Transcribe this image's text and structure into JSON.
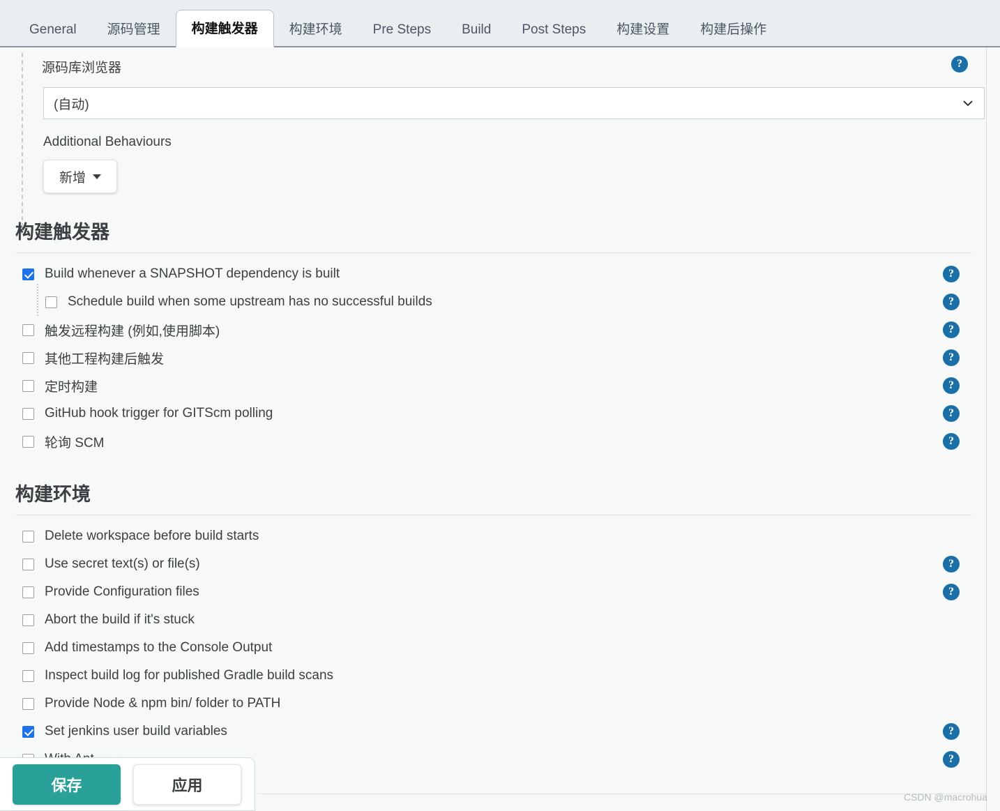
{
  "tabs": [
    {
      "label": "General",
      "active": false
    },
    {
      "label": "源码管理",
      "active": false
    },
    {
      "label": "构建触发器",
      "active": true
    },
    {
      "label": "构建环境",
      "active": false
    },
    {
      "label": "Pre Steps",
      "active": false
    },
    {
      "label": "Build",
      "active": false
    },
    {
      "label": "Post Steps",
      "active": false
    },
    {
      "label": "构建设置",
      "active": false
    },
    {
      "label": "构建后操作",
      "active": false
    }
  ],
  "scm_block": {
    "label": "源码库浏览器",
    "select_value": "(自动)",
    "select_options": [
      "(自动)"
    ],
    "additional_behaviours_label": "Additional Behaviours",
    "add_button_label": "新增",
    "help_glyph": "?",
    "chevron_icon": "chevron-down-icon"
  },
  "triggers_section": {
    "title": "构建触发器",
    "rows": [
      {
        "label": "Build whenever a SNAPSHOT dependency is built",
        "checked": true,
        "indent": false,
        "help": true
      },
      {
        "label": "Schedule build when some upstream has no successful builds",
        "checked": false,
        "indent": true,
        "help": true
      },
      {
        "label": "触发远程构建 (例如,使用脚本)",
        "checked": false,
        "indent": false,
        "help": true
      },
      {
        "label": "其他工程构建后触发",
        "checked": false,
        "indent": false,
        "help": true
      },
      {
        "label": "定时构建",
        "checked": false,
        "indent": false,
        "help": true
      },
      {
        "label": "GitHub hook trigger for GITScm polling",
        "checked": false,
        "indent": false,
        "help": true
      },
      {
        "label": "轮询 SCM",
        "checked": false,
        "indent": false,
        "help": true
      }
    ]
  },
  "environment_section": {
    "title": "构建环境",
    "rows": [
      {
        "label": "Delete workspace before build starts",
        "checked": false,
        "indent": false,
        "help": false
      },
      {
        "label": "Use secret text(s) or file(s)",
        "checked": false,
        "indent": false,
        "help": true
      },
      {
        "label": "Provide Configuration files",
        "checked": false,
        "indent": false,
        "help": true
      },
      {
        "label": "Abort the build if it's stuck",
        "checked": false,
        "indent": false,
        "help": false
      },
      {
        "label": "Add timestamps to the Console Output",
        "checked": false,
        "indent": false,
        "help": false
      },
      {
        "label": "Inspect build log for published Gradle build scans",
        "checked": false,
        "indent": false,
        "help": false
      },
      {
        "label": "Provide Node & npm bin/ folder to PATH",
        "checked": false,
        "indent": false,
        "help": false
      },
      {
        "label": "Set jenkins user build variables",
        "checked": true,
        "indent": false,
        "help": true
      },
      {
        "label": "With Ant",
        "checked": false,
        "indent": false,
        "help": true
      }
    ]
  },
  "bottom_bar": {
    "save_label": "保存",
    "apply_label": "应用"
  },
  "watermark": "CSDN @macrohua",
  "colors": {
    "accent_checked": "#1a73e8",
    "help_blue": "#1b6fa8",
    "save_teal": "#2aa198",
    "tabbar_bg": "#e9eef1",
    "page_bg": "#f7f8f8"
  }
}
